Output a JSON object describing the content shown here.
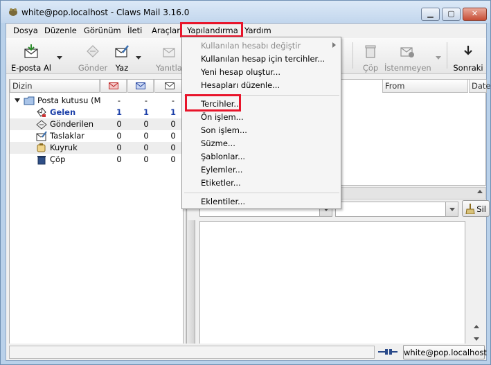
{
  "window": {
    "title": "white@pop.localhost - Claws Mail 3.16.0"
  },
  "menubar": {
    "items": [
      "Dosya",
      "Düzenle",
      "Görünüm",
      "İleti",
      "Araçlar",
      "Yapılandırma",
      "Yardım"
    ]
  },
  "toolbar": {
    "get_mail": "E-posta Al",
    "send": "Gönder",
    "compose": "Yaz",
    "reply": "Yanıtla",
    "trash": "Çöp",
    "junk": "İstenmeyen",
    "next": "Sonraki"
  },
  "folder_pane": {
    "header": "Dizin",
    "mailbox": "Posta kutusu (M",
    "mailbox_counts": [
      "-",
      "-",
      "-"
    ],
    "folders": [
      {
        "name": "Gelen",
        "icon": "inbox-icon",
        "counts": [
          "1",
          "1",
          "1"
        ],
        "bold": true
      },
      {
        "name": "Gönderilen",
        "icon": "sent-icon",
        "counts": [
          "0",
          "0",
          "0"
        ]
      },
      {
        "name": "Taslaklar",
        "icon": "drafts-icon",
        "counts": [
          "0",
          "0",
          "0"
        ]
      },
      {
        "name": "Kuyruk",
        "icon": "queue-icon",
        "counts": [
          "0",
          "0",
          "0"
        ]
      },
      {
        "name": "Çöp",
        "icon": "trash-icon",
        "counts": [
          "0",
          "0",
          "0"
        ]
      }
    ]
  },
  "message_list": {
    "columns": [
      "From",
      "Date"
    ]
  },
  "search": {
    "clear_button": "Sil"
  },
  "statusbar": {
    "account": "white@pop.localhost"
  },
  "dropdown": {
    "items": [
      {
        "label": "Kullanılan hesabı değiştir",
        "disabled": true,
        "submenu": true
      },
      {
        "label": "Kullanılan hesap için tercihler..."
      },
      {
        "label": "Yeni hesap oluştur..."
      },
      {
        "label": "Hesapları düzenle..."
      },
      {
        "label": "Tercihler..."
      },
      {
        "label": "Ön işlem..."
      },
      {
        "label": "Son işlem..."
      },
      {
        "label": "Süzme..."
      },
      {
        "label": "Şablonlar..."
      },
      {
        "label": "Eylemler..."
      },
      {
        "label": "Etiketler..."
      },
      {
        "label": "Eklentiler..."
      }
    ]
  },
  "colors": {
    "highlight": "#e8142a",
    "bold_folder": "#1b3fa8"
  }
}
